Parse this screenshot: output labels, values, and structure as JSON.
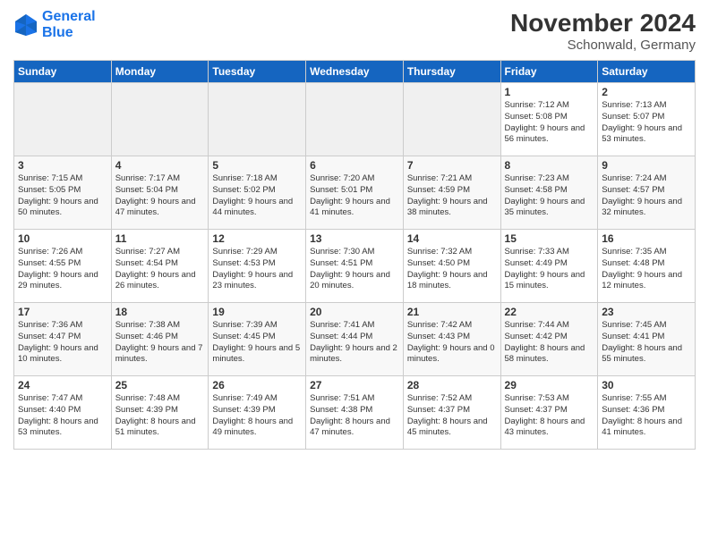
{
  "logo": {
    "line1": "General",
    "line2": "Blue"
  },
  "title": "November 2024",
  "subtitle": "Schonwald, Germany",
  "days_of_week": [
    "Sunday",
    "Monday",
    "Tuesday",
    "Wednesday",
    "Thursday",
    "Friday",
    "Saturday"
  ],
  "weeks": [
    [
      {
        "day": "",
        "info": ""
      },
      {
        "day": "",
        "info": ""
      },
      {
        "day": "",
        "info": ""
      },
      {
        "day": "",
        "info": ""
      },
      {
        "day": "",
        "info": ""
      },
      {
        "day": "1",
        "info": "Sunrise: 7:12 AM\nSunset: 5:08 PM\nDaylight: 9 hours and 56 minutes."
      },
      {
        "day": "2",
        "info": "Sunrise: 7:13 AM\nSunset: 5:07 PM\nDaylight: 9 hours and 53 minutes."
      }
    ],
    [
      {
        "day": "3",
        "info": "Sunrise: 7:15 AM\nSunset: 5:05 PM\nDaylight: 9 hours and 50 minutes."
      },
      {
        "day": "4",
        "info": "Sunrise: 7:17 AM\nSunset: 5:04 PM\nDaylight: 9 hours and 47 minutes."
      },
      {
        "day": "5",
        "info": "Sunrise: 7:18 AM\nSunset: 5:02 PM\nDaylight: 9 hours and 44 minutes."
      },
      {
        "day": "6",
        "info": "Sunrise: 7:20 AM\nSunset: 5:01 PM\nDaylight: 9 hours and 41 minutes."
      },
      {
        "day": "7",
        "info": "Sunrise: 7:21 AM\nSunset: 4:59 PM\nDaylight: 9 hours and 38 minutes."
      },
      {
        "day": "8",
        "info": "Sunrise: 7:23 AM\nSunset: 4:58 PM\nDaylight: 9 hours and 35 minutes."
      },
      {
        "day": "9",
        "info": "Sunrise: 7:24 AM\nSunset: 4:57 PM\nDaylight: 9 hours and 32 minutes."
      }
    ],
    [
      {
        "day": "10",
        "info": "Sunrise: 7:26 AM\nSunset: 4:55 PM\nDaylight: 9 hours and 29 minutes."
      },
      {
        "day": "11",
        "info": "Sunrise: 7:27 AM\nSunset: 4:54 PM\nDaylight: 9 hours and 26 minutes."
      },
      {
        "day": "12",
        "info": "Sunrise: 7:29 AM\nSunset: 4:53 PM\nDaylight: 9 hours and 23 minutes."
      },
      {
        "day": "13",
        "info": "Sunrise: 7:30 AM\nSunset: 4:51 PM\nDaylight: 9 hours and 20 minutes."
      },
      {
        "day": "14",
        "info": "Sunrise: 7:32 AM\nSunset: 4:50 PM\nDaylight: 9 hours and 18 minutes."
      },
      {
        "day": "15",
        "info": "Sunrise: 7:33 AM\nSunset: 4:49 PM\nDaylight: 9 hours and 15 minutes."
      },
      {
        "day": "16",
        "info": "Sunrise: 7:35 AM\nSunset: 4:48 PM\nDaylight: 9 hours and 12 minutes."
      }
    ],
    [
      {
        "day": "17",
        "info": "Sunrise: 7:36 AM\nSunset: 4:47 PM\nDaylight: 9 hours and 10 minutes."
      },
      {
        "day": "18",
        "info": "Sunrise: 7:38 AM\nSunset: 4:46 PM\nDaylight: 9 hours and 7 minutes."
      },
      {
        "day": "19",
        "info": "Sunrise: 7:39 AM\nSunset: 4:45 PM\nDaylight: 9 hours and 5 minutes."
      },
      {
        "day": "20",
        "info": "Sunrise: 7:41 AM\nSunset: 4:44 PM\nDaylight: 9 hours and 2 minutes."
      },
      {
        "day": "21",
        "info": "Sunrise: 7:42 AM\nSunset: 4:43 PM\nDaylight: 9 hours and 0 minutes."
      },
      {
        "day": "22",
        "info": "Sunrise: 7:44 AM\nSunset: 4:42 PM\nDaylight: 8 hours and 58 minutes."
      },
      {
        "day": "23",
        "info": "Sunrise: 7:45 AM\nSunset: 4:41 PM\nDaylight: 8 hours and 55 minutes."
      }
    ],
    [
      {
        "day": "24",
        "info": "Sunrise: 7:47 AM\nSunset: 4:40 PM\nDaylight: 8 hours and 53 minutes."
      },
      {
        "day": "25",
        "info": "Sunrise: 7:48 AM\nSunset: 4:39 PM\nDaylight: 8 hours and 51 minutes."
      },
      {
        "day": "26",
        "info": "Sunrise: 7:49 AM\nSunset: 4:39 PM\nDaylight: 8 hours and 49 minutes."
      },
      {
        "day": "27",
        "info": "Sunrise: 7:51 AM\nSunset: 4:38 PM\nDaylight: 8 hours and 47 minutes."
      },
      {
        "day": "28",
        "info": "Sunrise: 7:52 AM\nSunset: 4:37 PM\nDaylight: 8 hours and 45 minutes."
      },
      {
        "day": "29",
        "info": "Sunrise: 7:53 AM\nSunset: 4:37 PM\nDaylight: 8 hours and 43 minutes."
      },
      {
        "day": "30",
        "info": "Sunrise: 7:55 AM\nSunset: 4:36 PM\nDaylight: 8 hours and 41 minutes."
      }
    ]
  ]
}
